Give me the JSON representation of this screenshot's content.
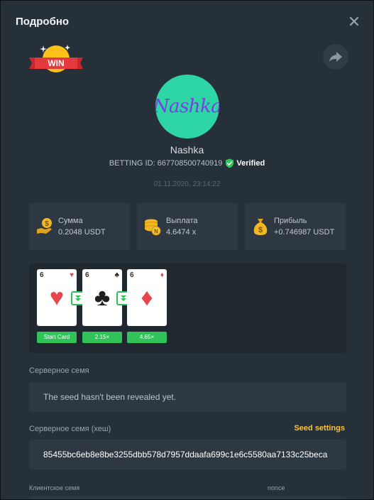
{
  "header": {
    "title": "Подробно"
  },
  "badge": {
    "text": "WIN"
  },
  "user": {
    "avatar_text": "Nashka",
    "name": "Nashka",
    "betting_id": "BETTING ID: 667708500740919",
    "verified_label": "Verified",
    "timestamp": "01.11.2020, 23:14:22"
  },
  "stats": [
    {
      "label": "Сумма",
      "value": "0.2048 USDT",
      "icon": "money-hand-icon"
    },
    {
      "label": "Выплата",
      "value": "4.6474 x",
      "icon": "coins-stack-icon"
    },
    {
      "label": "Прибыль",
      "value": "+0.746987 USDT",
      "icon": "money-bag-icon"
    }
  ],
  "game": {
    "cards": [
      {
        "rank": "6",
        "suit": "hearts",
        "symbol": "♥",
        "label": "Start Card"
      },
      {
        "rank": "6",
        "suit": "clubs",
        "symbol": "♣",
        "label": "2.15×"
      },
      {
        "rank": "6",
        "suit": "diamonds",
        "symbol": "♦",
        "label": "4.65×"
      }
    ]
  },
  "server_seed": {
    "label": "Серверное семя",
    "value": "The seed hasn't been revealed yet."
  },
  "server_seed_hash": {
    "label": "Серверное семя (хеш)",
    "settings_link": "Seed settings",
    "value": "85455bc6eb8e8be3255dbb578d7957ddaafa699c1e6c5580aa7133c25beca"
  },
  "client_seed": {
    "label": "Клиентское семя",
    "nonce_label": "nonce"
  },
  "colors": {
    "accent_green": "#31c25a",
    "link_yellow": "#ffc233",
    "panel": "#2e3842",
    "background": "#263039"
  }
}
